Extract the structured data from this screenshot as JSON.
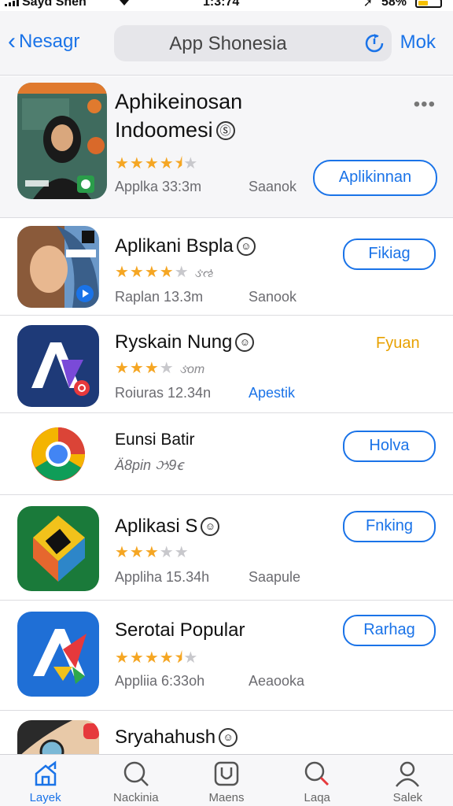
{
  "status_bar": {
    "carrier": "Sayd Shen",
    "time": "1:3:74",
    "battery": "58%"
  },
  "nav": {
    "back_label": "Nesagr",
    "title": "App Shonesia",
    "right_label": "Mok",
    "refresh_icon": "refresh-icon"
  },
  "apps": [
    {
      "name_line1": "Aphikeinosan",
      "name_line2": "Indoomesi",
      "badge": "Ⓢ",
      "rating": 4.5,
      "stars": "★★★★★",
      "meta1": "Applka 33:3m",
      "meta2": "Saanok",
      "button": "Aplikinnan",
      "more": "•••",
      "icon": "teacher-photo-icon"
    },
    {
      "name": "Aplikani Bspla",
      "badge": "☺",
      "rating": 4,
      "extra": "ઙઌ",
      "meta1": "Raplan 13.3m",
      "meta2": "Sanook",
      "button": "Fikiag",
      "icon": "woman-photo-icon"
    },
    {
      "name": "Ryskain Nung",
      "badge": "☺",
      "rating": 3,
      "extra": "ઙom",
      "meta1": "Roiuras 12.34n",
      "meta2": "Apestik",
      "button": "Fyuan",
      "icon": "a-logo-icon"
    },
    {
      "name": "Eunsi Batir",
      "meta1": "Ä8pin ઝ9ꞓ",
      "button": "Holva",
      "icon": "chrome-icon"
    },
    {
      "name": "Aplikasi S",
      "badge": "☺",
      "rating": 3,
      "meta1": "Appliha 15.34h",
      "meta2": "Saapule",
      "button": "Fnking",
      "icon": "cube-icon"
    },
    {
      "name": "Serotai Popular",
      "rating": 4.5,
      "meta1": "Appliia 6:33oh",
      "meta2": "Aeaooka",
      "button": "Rarhag",
      "icon": "a-colorful-icon"
    },
    {
      "name": "Sryahahush",
      "badge": "☺",
      "icon": "person-glasses-icon"
    }
  ],
  "tabs": [
    {
      "label": "Layek",
      "icon": "home-icon",
      "active": true
    },
    {
      "label": "Nackinia",
      "icon": "search-bubble-icon",
      "active": false
    },
    {
      "label": "Maens",
      "icon": "box-icon",
      "active": false
    },
    {
      "label": "Laqa",
      "icon": "search-icon",
      "active": false
    },
    {
      "label": "Salek",
      "icon": "profile-icon",
      "active": false
    }
  ],
  "colors": {
    "accent": "#1a73e8",
    "star": "#f5a623",
    "orange_text": "#e8a100"
  }
}
